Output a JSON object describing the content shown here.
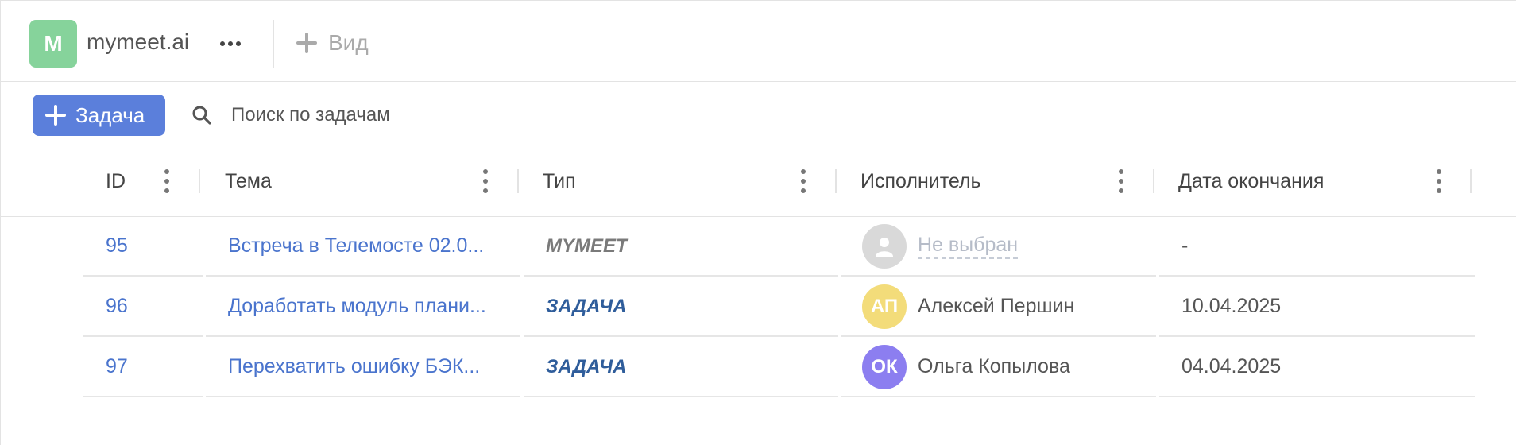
{
  "workspace": {
    "initial": "M",
    "name": "mymeet.ai",
    "avatar_color": "#86d39b"
  },
  "views": {
    "add_view_label": "Вид"
  },
  "toolbar": {
    "add_task_label": "Задача",
    "search_placeholder": "Поиск по задачам",
    "accent_color": "#5b7fdb"
  },
  "table": {
    "columns": [
      {
        "label": "ID"
      },
      {
        "label": "Тема"
      },
      {
        "label": "Тип"
      },
      {
        "label": "Исполнитель"
      },
      {
        "label": "Дата окончания"
      }
    ],
    "rows": [
      {
        "id": "95",
        "topic": "Встреча в Телемосте 02.0...",
        "type": "MYMEET",
        "type_color": "#7a7a7a",
        "executor": "Не выбран",
        "executor_initials": "",
        "executor_color": "#d9d9d9",
        "date": "-"
      },
      {
        "id": "96",
        "topic": "Доработать модуль плани...",
        "type": "ЗАДАЧА",
        "type_color": "#2f5d9b",
        "executor": "Алексей Першин",
        "executor_initials": "АП",
        "executor_color": "#f3dc7a",
        "date": "10.04.2025"
      },
      {
        "id": "97",
        "topic": "Перехватить ошибку БЭК...",
        "type": "ЗАДАЧА",
        "type_color": "#2f5d9b",
        "executor": "Ольга Копылова",
        "executor_initials": "ОК",
        "executor_color": "#8c7ef0",
        "date": "04.04.2025"
      }
    ]
  }
}
